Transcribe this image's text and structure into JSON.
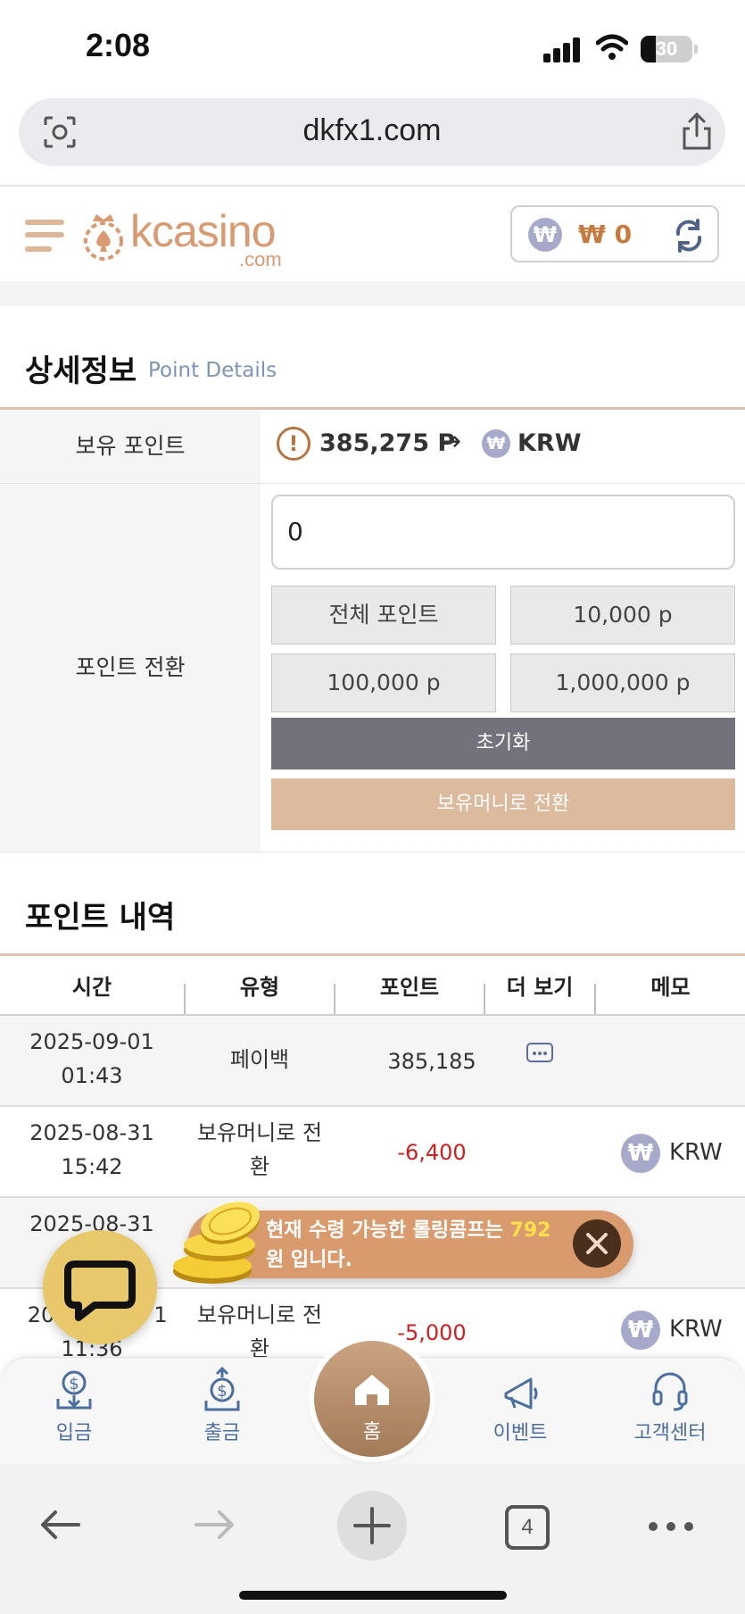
{
  "status_bar": {
    "time": "2:08",
    "battery": "30",
    "battery_level_percent": 30
  },
  "browser": {
    "url": "dkfx1.com",
    "tab_count": "4"
  },
  "header": {
    "logo_text": "kcasino",
    "logo_sub": ".com",
    "currency_symbol": "₩",
    "balance": "₩ 0"
  },
  "details": {
    "title": "상세정보",
    "subtitle": "Point Details",
    "held_points_label": "보유 포인트",
    "held_points_value": "385,275 P",
    "arrow": "→",
    "currency_badge": "₩",
    "target_currency": "KRW",
    "convert_label": "포인트 전환",
    "input_value": "0",
    "presets": [
      "전체 포인트",
      "10,000 p",
      "100,000 p",
      "1,000,000 p"
    ],
    "reset_label": "초기화",
    "convert_button_label": "보유머니로 전환"
  },
  "history": {
    "title": "포인트 내역",
    "columns": [
      "시간",
      "유형",
      "포인트",
      "더 보기",
      "메모"
    ],
    "rows": [
      {
        "date": "2025-09-01",
        "time": "01:43",
        "type_line1": "페이백",
        "type_line2": "",
        "points": "385,185",
        "more": true,
        "memo": ""
      },
      {
        "date": "2025-08-31",
        "time": "15:42",
        "type_line1": "보유머니로 전",
        "type_line2": "환",
        "points": "-6,400",
        "more": false,
        "memo": "KRW"
      },
      {
        "date": "2025-08-31",
        "time": "",
        "type_line1": "",
        "type_line2": "",
        "points": "",
        "more": false,
        "memo": ""
      },
      {
        "date": "20",
        "date_tail": "1",
        "time": "11:36",
        "type_line1": "보유머니로 전",
        "type_line2": "환",
        "points": "-5,000",
        "more": false,
        "memo": "KRW"
      }
    ]
  },
  "toast": {
    "text_before": "현재 수령 가능한 롤링콤프는 ",
    "amount": "792",
    "text_after": "원 입니다."
  },
  "bottom_nav": {
    "items": [
      "입금",
      "출금",
      "홈",
      "이벤트",
      "고객센터"
    ]
  },
  "colors": {
    "accent_tan": "#dbba9d",
    "negative": "#cc1f1f",
    "nav_blue": "#4b6ea0",
    "reset_gray": "#71727c",
    "balance_orange": "#c87a3e"
  }
}
